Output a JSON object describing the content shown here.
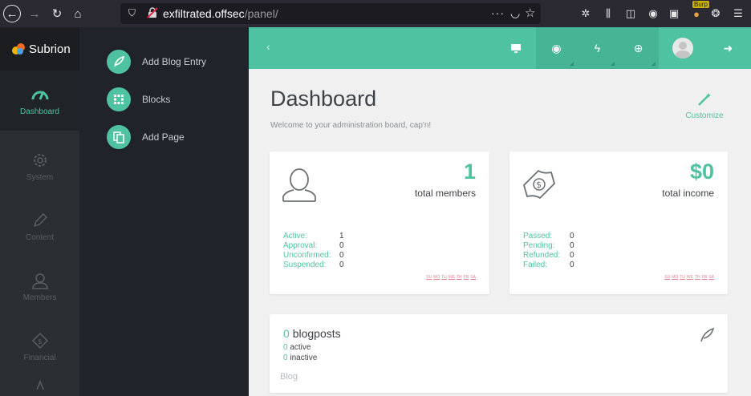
{
  "browser": {
    "url_host": "exfiltrated.offsec",
    "url_path": "/panel/",
    "burp_badge": "Burp"
  },
  "sidebar": {
    "brand": "Subrion",
    "items": [
      {
        "label": "Dashboard",
        "icon": "speedometer-icon",
        "active": true
      },
      {
        "label": "System",
        "icon": "gear-icon",
        "active": false
      },
      {
        "label": "Content",
        "icon": "pencil-icon",
        "active": false
      },
      {
        "label": "Members",
        "icon": "user-icon",
        "active": false
      },
      {
        "label": "Financial",
        "icon": "money-icon",
        "active": false
      }
    ]
  },
  "submenu": {
    "items": [
      {
        "label": "Add Blog Entry",
        "icon": "feather-icon"
      },
      {
        "label": "Blocks",
        "icon": "grid-icon"
      },
      {
        "label": "Add Page",
        "icon": "pages-icon"
      }
    ]
  },
  "colors": {
    "accent": "#4fc3a1",
    "sidebar": "#2b2f33",
    "submenu": "#20232a"
  },
  "dashboard": {
    "title": "Dashboard",
    "subtitle": "Welcome to your administration board, cap'n!",
    "customize_label": "Customize",
    "members": {
      "value": "1",
      "caption": "total members",
      "stats": [
        {
          "k": "Active:",
          "v": "1"
        },
        {
          "k": "Approval:",
          "v": "0"
        },
        {
          "k": "Unconfirmed:",
          "v": "0"
        },
        {
          "k": "Suspended:",
          "v": "0"
        }
      ]
    },
    "income": {
      "value": "$0",
      "caption": "total income",
      "stats": [
        {
          "k": "Passed:",
          "v": "0"
        },
        {
          "k": "Pending:",
          "v": "0"
        },
        {
          "k": "Refunded:",
          "v": "0"
        },
        {
          "k": "Failed:",
          "v": "0"
        }
      ]
    },
    "spark_days": [
      "SU",
      "MO",
      "TU",
      "WE",
      "TH",
      "FR",
      "SA"
    ],
    "blog": {
      "count": "0",
      "label": "blogposts",
      "active_n": "0",
      "active_label": "active",
      "inactive_n": "0",
      "inactive_label": "inactive",
      "footer": "Blog"
    }
  }
}
